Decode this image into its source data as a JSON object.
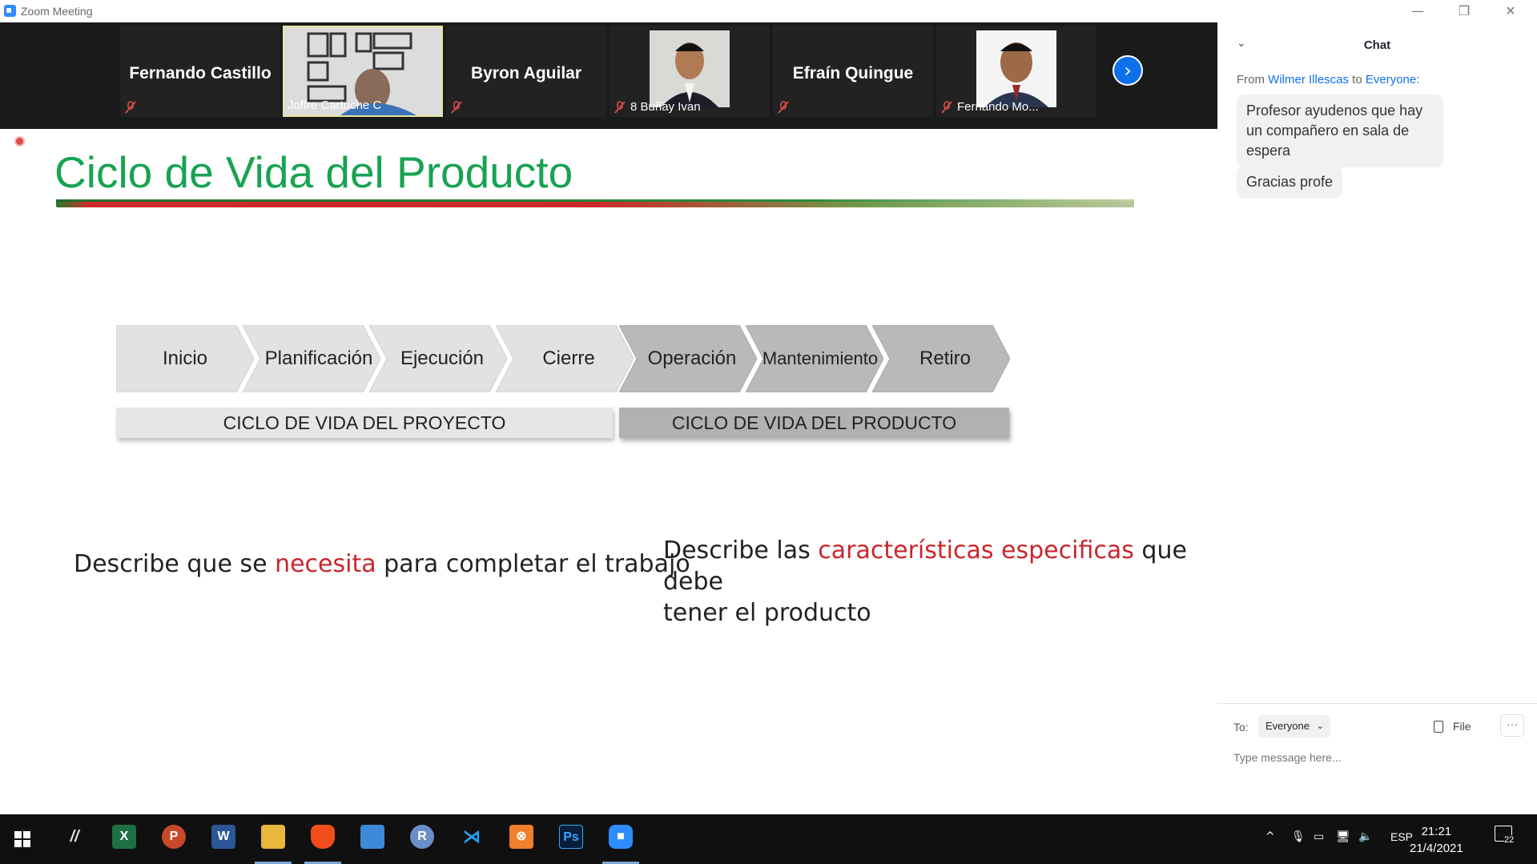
{
  "window": {
    "title": "Zoom Meeting",
    "controls": [
      "—",
      "❐",
      "✕"
    ]
  },
  "gallery": {
    "participants": [
      {
        "name": "Fernando Castillo",
        "video": false,
        "muted": true
      },
      {
        "name": "Joffre Cartuche C",
        "video": true,
        "muted": false,
        "active": true
      },
      {
        "name": "Byron Aguilar",
        "video": false,
        "muted": true
      },
      {
        "name": "8 Buñay Ivan",
        "video": true,
        "muted": true
      },
      {
        "name": "Efraín Quingue",
        "video": false,
        "muted": true
      },
      {
        "name": "Fernando Mo...",
        "video": true,
        "muted": true
      }
    ],
    "next_icon": "chevron-right-icon"
  },
  "slide": {
    "title": "Ciclo de Vida del Producto",
    "phases": [
      "Inicio",
      "Planificación",
      "Ejecución",
      "Cierre",
      "Operación",
      "Mantenimiento",
      "Retiro"
    ],
    "band_project": "CICLO DE VIDA DEL PROYECTO",
    "band_product": "CICLO DE VIDA DEL PRODUCTO",
    "left_desc": {
      "pre": "Describe  que se ",
      "highlight": "necesita",
      "post": " para completar el trabajo"
    },
    "right_desc": {
      "pre": "Describe  las ",
      "highlight": "características especificas",
      "post": " que debe",
      "line2": "tener el producto"
    },
    "colors": {
      "title": "#17a352",
      "highlight": "#c9262c"
    }
  },
  "chat": {
    "title": "Chat",
    "from_prefix": "From ",
    "from_name": "Wilmer Illescas",
    "to_word": " to ",
    "to_name": "Everyone",
    "to_suffix": ":",
    "messages": [
      "Profesor ayudenos que hay un compañero en sala de espera",
      "Gracias profe"
    ],
    "to_label": "To:",
    "recipient": "Everyone",
    "file_label": "File",
    "more_label": "···",
    "input_placeholder": "Type message here..."
  },
  "taskbar": {
    "apps": [
      "windows-start",
      "inkscape",
      "excel",
      "powerpoint",
      "word",
      "file-explorer",
      "brave",
      "contacts",
      "r",
      "vscode",
      "xampp",
      "photoshop",
      "zoom"
    ],
    "language": "ESP",
    "time": "21:21",
    "date": "21/4/2021",
    "notifications": "22"
  }
}
